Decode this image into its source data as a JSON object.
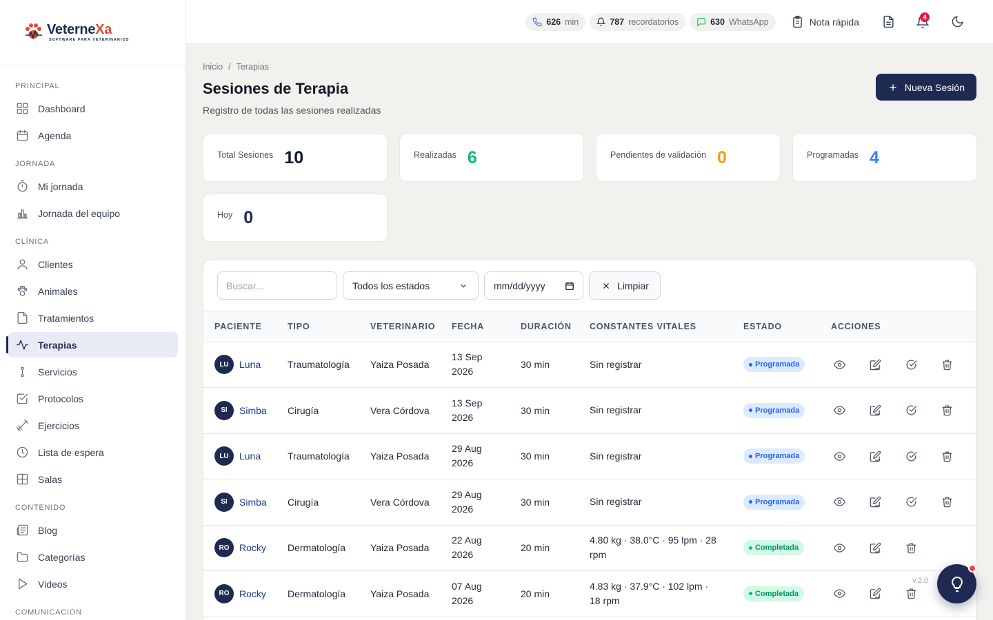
{
  "brand": {
    "name_main": "Veterne",
    "name_accent": "Xa",
    "tagline": "SOFTWARE PARA VETERINARIOS"
  },
  "sidebar": {
    "sections": [
      {
        "title": "PRINCIPAL",
        "items": [
          {
            "label": "Dashboard",
            "icon": "grid-icon"
          },
          {
            "label": "Agenda",
            "icon": "calendar-icon"
          }
        ]
      },
      {
        "title": "JORNADA",
        "items": [
          {
            "label": "Mi jornada",
            "icon": "stopwatch-icon"
          },
          {
            "label": "Jornada del equipo",
            "icon": "bar-chart-icon"
          }
        ]
      },
      {
        "title": "CLÍNICA",
        "items": [
          {
            "label": "Clientes",
            "icon": "user-icon"
          },
          {
            "label": "Animales",
            "icon": "paw-icon"
          },
          {
            "label": "Tratamientos",
            "icon": "file-icon"
          },
          {
            "label": "Terapias",
            "icon": "activity-icon",
            "active": true
          },
          {
            "label": "Servicios",
            "icon": "stethoscope-icon"
          },
          {
            "label": "Protocolos",
            "icon": "checklist-icon"
          },
          {
            "label": "Ejercicios",
            "icon": "dumbbell-icon"
          },
          {
            "label": "Lista de espera",
            "icon": "clock-icon"
          },
          {
            "label": "Salas",
            "icon": "rooms-icon"
          }
        ]
      },
      {
        "title": "CONTENIDO",
        "items": [
          {
            "label": "Blog",
            "icon": "newspaper-icon"
          },
          {
            "label": "Categorías",
            "icon": "folder-icon"
          },
          {
            "label": "Videos",
            "icon": "play-icon"
          }
        ]
      },
      {
        "title": "COMUNICACIÓN",
        "items": []
      }
    ]
  },
  "topbar": {
    "minutes": {
      "value": "626",
      "unit": "min"
    },
    "reminders": {
      "value": "787",
      "unit": "recordatorios"
    },
    "whatsapp": {
      "value": "630",
      "unit": "WhatsApp"
    },
    "quick_note": "Nota rápida",
    "notifications_count": "4"
  },
  "breadcrumb": {
    "home": "Inicio",
    "sep": "/",
    "current": "Terapias"
  },
  "page": {
    "title": "Sesiones de Terapia",
    "subtitle": "Registro de todas las sesiones realizadas",
    "new_button": "Nueva Sesión"
  },
  "stats": [
    {
      "label": "Total Sesiones",
      "value": "10",
      "color": "#111827"
    },
    {
      "label": "Realizadas",
      "value": "6",
      "color": "#10b981"
    },
    {
      "label": "Pendientes de validación",
      "value": "0",
      "color": "#f59e0b"
    },
    {
      "label": "Programadas",
      "value": "4",
      "color": "#3b82f6"
    },
    {
      "label": "Hoy",
      "value": "0",
      "color": "#1e2a52"
    }
  ],
  "filters": {
    "search_placeholder": "Buscar...",
    "status_selected": "Todos los estados",
    "date_placeholder": "mm/dd/yyyy",
    "clear_label": "Limpiar"
  },
  "table": {
    "headers": [
      "PACIENTE",
      "TIPO",
      "VETERINARIO",
      "FECHA",
      "DURACIÓN",
      "CONSTANTES VITALES",
      "ESTADO",
      "ACCIONES"
    ],
    "rows": [
      {
        "initials": "LU",
        "patient": "Luna",
        "type": "Traumatología",
        "vet": "Yaiza Posada",
        "date1": "13 Sep",
        "date2": "2026",
        "duration": "30 min",
        "vitals": "Sin registrar",
        "status": "Programada"
      },
      {
        "initials": "SI",
        "patient": "Simba",
        "type": "Cirugía",
        "vet": "Vera Córdova",
        "date1": "13 Sep",
        "date2": "2026",
        "duration": "30 min",
        "vitals": "Sin registrar",
        "status": "Programada"
      },
      {
        "initials": "LU",
        "patient": "Luna",
        "type": "Traumatología",
        "vet": "Yaiza Posada",
        "date1": "29 Aug",
        "date2": "2026",
        "duration": "30 min",
        "vitals": "Sin registrar",
        "status": "Programada"
      },
      {
        "initials": "SI",
        "patient": "Simba",
        "type": "Cirugía",
        "vet": "Vera Córdova",
        "date1": "29 Aug",
        "date2": "2026",
        "duration": "30 min",
        "vitals": "Sin registrar",
        "status": "Programada"
      },
      {
        "initials": "RO",
        "patient": "Rocky",
        "type": "Dermatología",
        "vet": "Yaiza Posada",
        "date1": "22 Aug",
        "date2": "2026",
        "duration": "20 min",
        "vitals": "4.80 kg · 38.0°C · 95 lpm · 28 rpm",
        "status": "Completada"
      },
      {
        "initials": "RO",
        "patient": "Rocky",
        "type": "Dermatología",
        "vet": "Yaiza Posada",
        "date1": "07 Aug",
        "date2": "2026",
        "duration": "20 min",
        "vitals": "4.83 kg · 37.9°C · 102 lpm · 18 rpm",
        "status": "Completada"
      }
    ]
  },
  "version": "v.2.0"
}
